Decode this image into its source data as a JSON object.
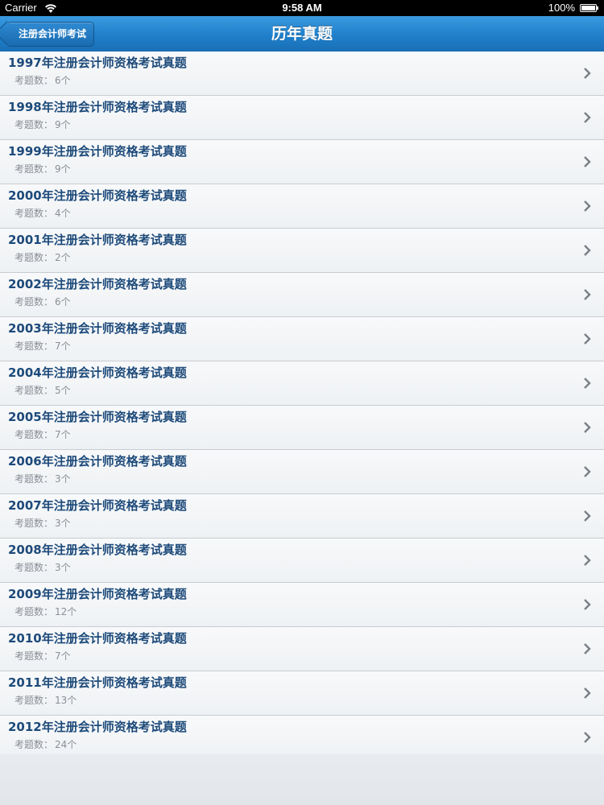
{
  "status_bar": {
    "carrier": "Carrier",
    "time": "9:58 AM",
    "battery": "100%"
  },
  "nav": {
    "back_label": "注册会计师考试",
    "title": "历年真题"
  },
  "list": {
    "count_label": "考题数：",
    "items": [
      {
        "title": "1997年注册会计师资格考试真题",
        "count": "6个"
      },
      {
        "title": "1998年注册会计师资格考试真题",
        "count": "9个"
      },
      {
        "title": "1999年注册会计师资格考试真题",
        "count": "9个"
      },
      {
        "title": "2000年注册会计师资格考试真题",
        "count": "4个"
      },
      {
        "title": "2001年注册会计师资格考试真题",
        "count": "2个"
      },
      {
        "title": "2002年注册会计师资格考试真题",
        "count": "6个"
      },
      {
        "title": "2003年注册会计师资格考试真题",
        "count": "7个"
      },
      {
        "title": "2004年注册会计师资格考试真题",
        "count": "5个"
      },
      {
        "title": "2005年注册会计师资格考试真题",
        "count": "7个"
      },
      {
        "title": "2006年注册会计师资格考试真题",
        "count": "3个"
      },
      {
        "title": "2007年注册会计师资格考试真题",
        "count": "3个"
      },
      {
        "title": "2008年注册会计师资格考试真题",
        "count": "3个"
      },
      {
        "title": "2009年注册会计师资格考试真题",
        "count": "12个"
      },
      {
        "title": "2010年注册会计师资格考试真题",
        "count": "7个"
      },
      {
        "title": "2011年注册会计师资格考试真题",
        "count": "13个"
      },
      {
        "title": "2012年注册会计师资格考试真题",
        "count": "24个"
      }
    ]
  },
  "colors": {
    "nav_blue": "#1f7fcb",
    "title_text": "#1d4a7a",
    "sub_text": "#8a8f96"
  },
  "icons": {
    "wifi": "wifi-icon",
    "battery": "battery-icon",
    "back": "back-arrow-icon",
    "chevron": "chevron-right-icon"
  }
}
